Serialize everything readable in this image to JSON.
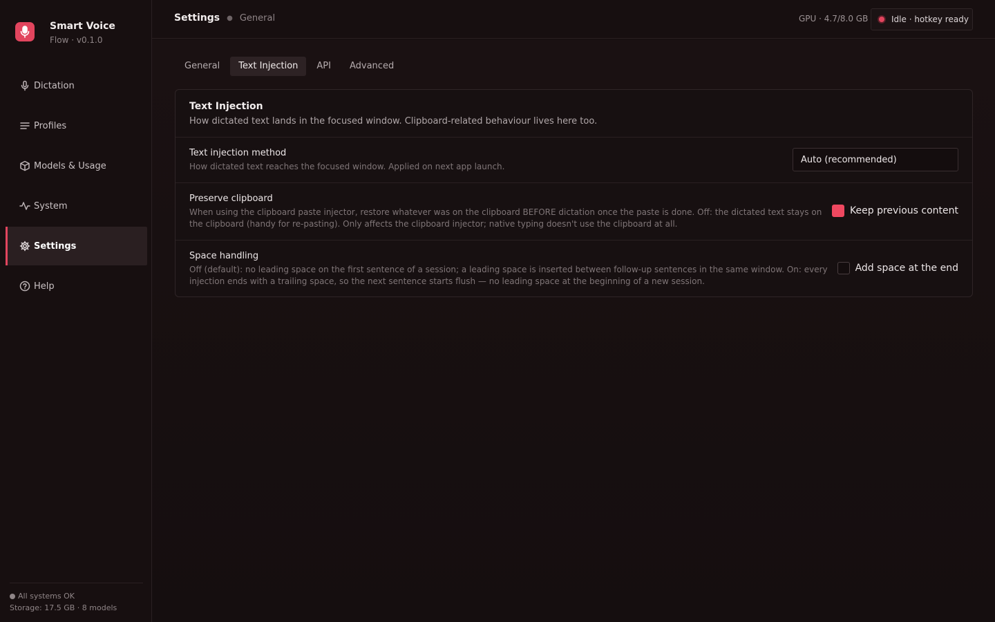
{
  "brand": {
    "name": "Smart Voice",
    "subtitle": "Flow · v0.1.0",
    "logo_icon": "microphone-icon",
    "accent": "#e2455e"
  },
  "sidebar": {
    "items": [
      {
        "label": "Dictation",
        "icon": "microphone-icon"
      },
      {
        "label": "Profiles",
        "icon": "list-icon"
      },
      {
        "label": "Models & Usage",
        "icon": "cube-icon"
      },
      {
        "label": "System",
        "icon": "activity-icon"
      },
      {
        "label": "Settings",
        "icon": "gear-icon",
        "active": true
      },
      {
        "label": "Help",
        "icon": "help-icon"
      }
    ],
    "footer": {
      "status": "All systems OK",
      "storage": "Storage: 17.5 GB · 8 models"
    }
  },
  "header": {
    "title": "Settings",
    "section": "General",
    "gpu": "GPU · 4.7/8.0 GB",
    "status": "Idle · hotkey ready"
  },
  "tabs": [
    {
      "label": "General"
    },
    {
      "label": "Text Injection",
      "active": true
    },
    {
      "label": "API"
    },
    {
      "label": "Advanced"
    }
  ],
  "card": {
    "title": "Text Injection",
    "description": "How dictated text lands in the focused window. Clipboard-related behaviour lives here too.",
    "rows": [
      {
        "label": "Text injection method",
        "help": "How dictated text reaches the focused window. Applied on next app launch.",
        "select_value": "Auto (recommended)"
      },
      {
        "label": "Preserve clipboard",
        "help": "When using the clipboard paste injector, restore whatever was on the clipboard BEFORE dictation once the paste is done. Off: the dictated text stays on the clipboard (handy for re-pasting). Only affects the clipboard injector; native typing doesn't use the clipboard at all.",
        "checkbox_label": "Keep previous content",
        "checked": true
      },
      {
        "label": "Space handling",
        "help": "Off (default): no leading space on the first sentence of a session; a leading space is inserted between follow-up sentences in the same window. On: every injection ends with a trailing space, so the next sentence starts flush — no leading space at the beginning of a new session.",
        "checkbox_label": "Add space at the end",
        "checked": false
      }
    ]
  }
}
